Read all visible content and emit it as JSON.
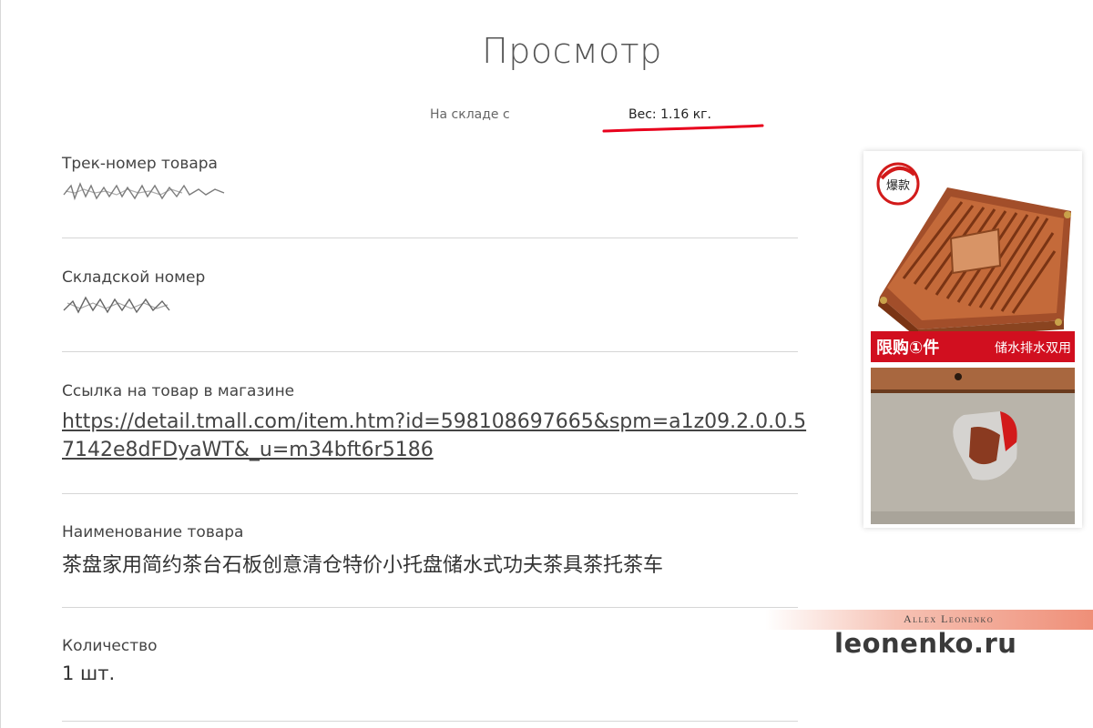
{
  "page": {
    "title": "Просмотр"
  },
  "subtabs": {
    "in_stock": "На складе с",
    "weight": "Вес: 1.16 кг."
  },
  "fields": {
    "tracking": {
      "label": "Трек-номер товара"
    },
    "warehouse": {
      "label": "Складской номер"
    },
    "link": {
      "label": "Ссылка на товар в магазине",
      "value": "https://detail.tmall.com/item.htm?id=598108697665&spm=a1z09.2.0.0.57142e8dFDyaWT&_u=m34bft6r5186"
    },
    "name": {
      "label": "Наименование товара",
      "value": "茶盘家用简约茶台石板创意清仓特价小托盘储水式功夫茶具茶托茶车"
    },
    "quantity": {
      "label": "Количество",
      "value": "1 шт."
    }
  },
  "product_card": {
    "badge": "爆款",
    "promo_left": "限购①件",
    "promo_right": "储水排水双用"
  },
  "watermark": {
    "author": "Allex Leonenko",
    "site": "leonenko.ru"
  },
  "colors": {
    "accent_red": "#e8001c",
    "separator": "#d6d6d6",
    "wood": "#b05a33"
  }
}
